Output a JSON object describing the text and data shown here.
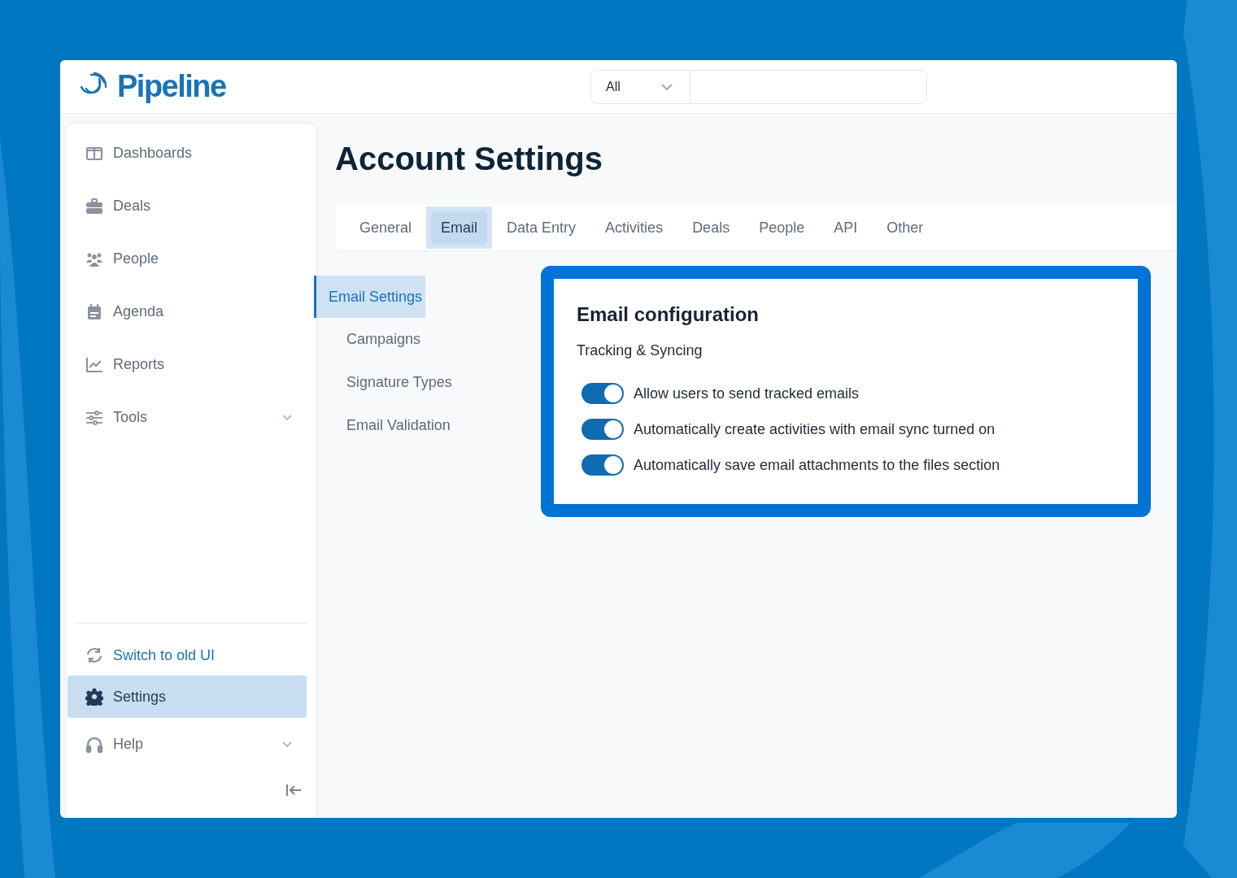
{
  "logo": {
    "text": "Pipeline"
  },
  "search": {
    "scope": "All"
  },
  "sidebar": {
    "items": [
      {
        "label": "Dashboards",
        "expandable": false
      },
      {
        "label": "Deals",
        "expandable": false
      },
      {
        "label": "People",
        "expandable": false
      },
      {
        "label": "Agenda",
        "expandable": false
      },
      {
        "label": "Reports",
        "expandable": false
      },
      {
        "label": "Tools",
        "expandable": true
      }
    ],
    "switch_link": "Switch to old UI",
    "bottom_items": [
      {
        "label": "Settings",
        "selected": true,
        "expandable": false
      },
      {
        "label": "Help",
        "selected": false,
        "expandable": true
      }
    ]
  },
  "page_title": "Account Settings",
  "tabs": [
    {
      "label": "General",
      "selected": false
    },
    {
      "label": "Email",
      "selected": true
    },
    {
      "label": "Data Entry",
      "selected": false
    },
    {
      "label": "Activities",
      "selected": false
    },
    {
      "label": "Deals",
      "selected": false
    },
    {
      "label": "People",
      "selected": false
    },
    {
      "label": "API",
      "selected": false
    },
    {
      "label": "Other",
      "selected": false
    }
  ],
  "subnav": [
    {
      "label": "Email Settings",
      "selected": true
    },
    {
      "label": "Campaigns",
      "selected": false
    },
    {
      "label": "Signature Types",
      "selected": false
    },
    {
      "label": "Email Validation",
      "selected": false
    }
  ],
  "panel": {
    "title": "Email configuration",
    "section": "Tracking & Syncing",
    "toggles": [
      {
        "label": "Allow users to send tracked emails",
        "on": true
      },
      {
        "label": "Automatically create activities with email sync turned on",
        "on": true
      },
      {
        "label": "Automatically save email attachments to the files section",
        "on": true
      }
    ]
  }
}
